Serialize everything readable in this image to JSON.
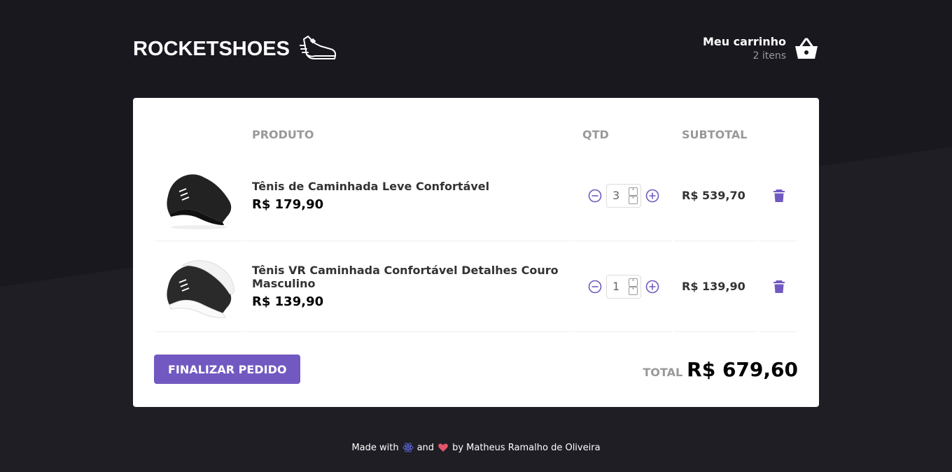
{
  "header": {
    "brand": "ROCKETSHOES",
    "cart_title": "Meu carrinho",
    "cart_count": "2 itens"
  },
  "table": {
    "headers": {
      "product": "PRODUTO",
      "qty": "QTD",
      "subtotal": "SUBTOTAL"
    },
    "items": [
      {
        "title": "Tênis de Caminhada Leve Confortável",
        "price": "R$ 179,90",
        "quantity": "3",
        "subtotal": "R$ 539,70",
        "image": "black-sneaker"
      },
      {
        "title": "Tênis VR Caminhada Confortável Detalhes Couro Masculino",
        "price": "R$ 139,90",
        "quantity": "1",
        "subtotal": "R$ 139,90",
        "image": "black-white-sneaker"
      }
    ]
  },
  "footer": {
    "finish_button": "FINALIZAR PEDIDO",
    "total_label": "TOTAL",
    "total_value": "R$ 679,60"
  },
  "credit": {
    "made_with": "Made with",
    "and": "and",
    "by": "by Matheus Ramalho de Oliveira"
  },
  "colors": {
    "background": "#19181f",
    "accent": "#7159c1",
    "heart": "#e5556a"
  },
  "icons": [
    "sneaker-logo-icon",
    "basket-icon",
    "minus-circle-icon",
    "plus-circle-icon",
    "trash-icon",
    "react-icon",
    "heart-icon"
  ]
}
